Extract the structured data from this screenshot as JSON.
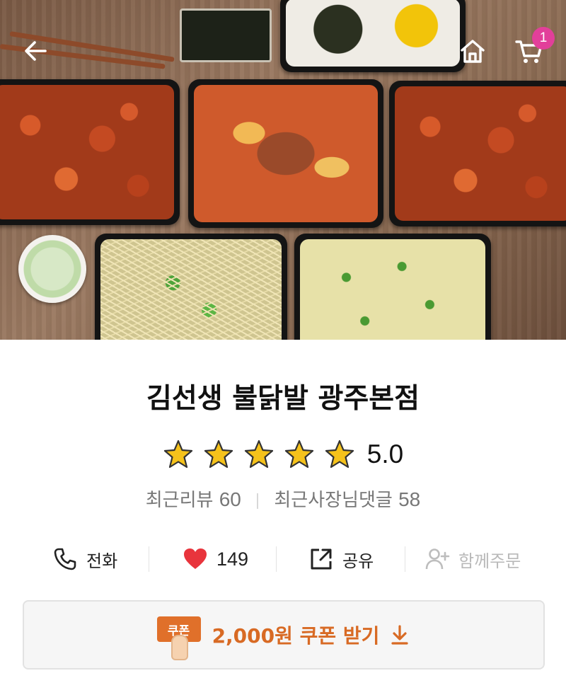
{
  "header": {
    "back_icon": "arrow-left-icon",
    "home_icon": "home-icon",
    "cart_icon": "cart-icon",
    "cart_count": "1"
  },
  "store": {
    "name": "김선생 불닭발 광주본점",
    "rating": 5.0,
    "rating_text": "5.0",
    "stars_filled": 5,
    "recent_reviews_label": "최근리뷰",
    "recent_reviews_count": "60",
    "recent_replies_label": "최근사장님댓글",
    "recent_replies_count": "58"
  },
  "actions": {
    "call_label": "전화",
    "like_count": "149",
    "share_label": "공유",
    "group_order_label": "함께주문"
  },
  "coupon": {
    "tag_label": "쿠폰",
    "cta_label": "2,000원 쿠폰 받기"
  },
  "colors": {
    "accent": "#d86a24",
    "badge": "#e23f9a",
    "heart": "#e8343c",
    "star": "#f5c21b"
  }
}
